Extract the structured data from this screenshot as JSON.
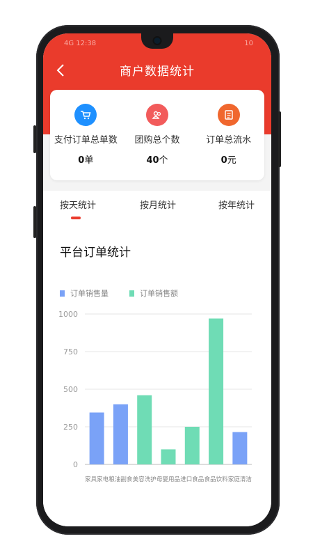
{
  "status": {
    "left": "4G  12:38",
    "right": "10"
  },
  "nav": {
    "title": "商户数据统计",
    "back_icon": "chevron-left-icon"
  },
  "stats": [
    {
      "label": "支付订单总单数",
      "value": "0",
      "unit": "单",
      "icon": "cart-icon",
      "color": "#1e90ff"
    },
    {
      "label": "团购总个数",
      "value": "40",
      "unit": "个",
      "icon": "group-icon",
      "color": "#f25b5b"
    },
    {
      "label": "订单总流水",
      "value": "0",
      "unit": "元",
      "icon": "ledger-icon",
      "color": "#f0672e"
    }
  ],
  "tabs": [
    {
      "label": "按天统计",
      "active": true
    },
    {
      "label": "按月统计",
      "active": false
    },
    {
      "label": "按年统计",
      "active": false
    }
  ],
  "chart_title": "平台订单统计",
  "colors": {
    "accent": "#ea3b2c",
    "series_a": "#7aa2f7",
    "series_b": "#6fdcb5"
  },
  "chart_data": {
    "type": "bar",
    "categories": [
      "家具家电",
      "粮油副食",
      "美容洗护",
      "母婴用品",
      "进口食品",
      "食品饮料",
      "家庭清洁"
    ],
    "series": [
      {
        "name": "订单销售量"
      },
      {
        "name": "订单销售额"
      }
    ],
    "bars": [
      {
        "category": "家具家电",
        "series": "订单销售量",
        "value": 345
      },
      {
        "category": "粮油副食",
        "series": "订单销售量",
        "value": 400
      },
      {
        "category": "美容洗护",
        "series": "订单销售额",
        "value": 460
      },
      {
        "category": "母婴用品",
        "series": "订单销售额",
        "value": 100
      },
      {
        "category": "进口食品",
        "series": "订单销售额",
        "value": 250
      },
      {
        "category": "食品饮料",
        "series": "订单销售额",
        "value": 970
      },
      {
        "category": "家庭清洁",
        "series": "订单销售量",
        "value": 215
      }
    ],
    "ylim": [
      0,
      1000
    ],
    "yticks": [
      0,
      250,
      500,
      750,
      1000
    ],
    "grid": true,
    "legend": "top-left"
  }
}
